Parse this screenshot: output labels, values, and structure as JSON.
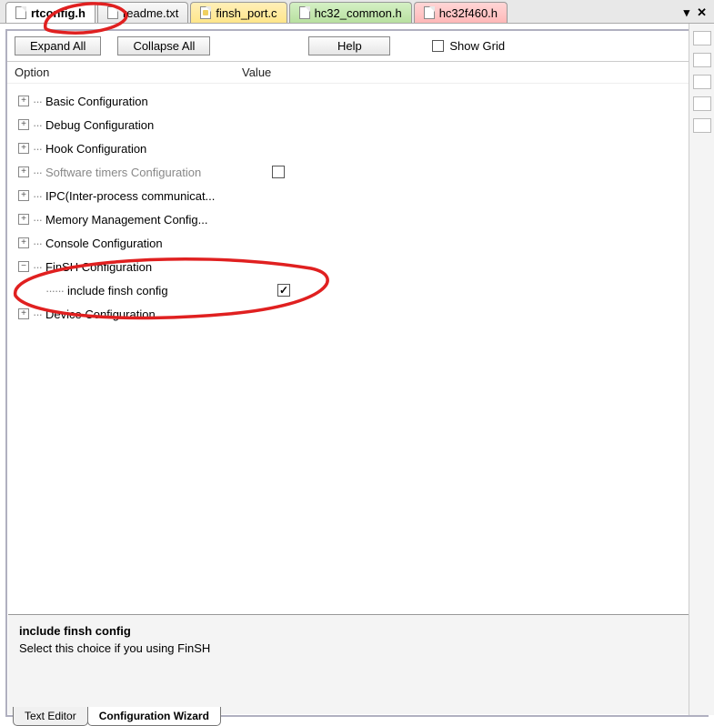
{
  "tabs": [
    {
      "label": "rtconfig.h",
      "active": true,
      "cls": ""
    },
    {
      "label": "readme.txt",
      "active": false,
      "cls": ""
    },
    {
      "label": "finsh_port.c",
      "active": false,
      "cls": "tab-yellow"
    },
    {
      "label": "hc32_common.h",
      "active": false,
      "cls": "tab-green"
    },
    {
      "label": "hc32f460.h",
      "active": false,
      "cls": "tab-pink"
    }
  ],
  "tabControls": {
    "dropdown": "▾",
    "close": "✕"
  },
  "toolbar": {
    "expandAll": "Expand All",
    "collapseAll": "Collapse All",
    "help": "Help",
    "showGrid": "Show Grid"
  },
  "headers": {
    "option": "Option",
    "value": "Value"
  },
  "tree": {
    "basic": {
      "exp": "+",
      "label": "Basic Configuration"
    },
    "debug": {
      "exp": "+",
      "label": "Debug Configuration"
    },
    "hook": {
      "exp": "+",
      "label": "Hook Configuration"
    },
    "swt": {
      "exp": "+",
      "label": "Software timers Configuration"
    },
    "ipc": {
      "exp": "+",
      "label": "IPC(Inter-process communicat..."
    },
    "mem": {
      "exp": "+",
      "label": "Memory Management Config..."
    },
    "console": {
      "exp": "+",
      "label": "Console Configuration"
    },
    "finsh": {
      "exp": "−",
      "label": "FinSH Configuration"
    },
    "finshInc": {
      "label": "include finsh config"
    },
    "device": {
      "exp": "+",
      "label": "Device Configuration"
    }
  },
  "helpPanel": {
    "title": "include finsh config",
    "desc": "Select this choice if you using FinSH"
  },
  "bottomTabs": {
    "textEditor": "Text Editor",
    "configWizard": "Configuration Wizard"
  }
}
